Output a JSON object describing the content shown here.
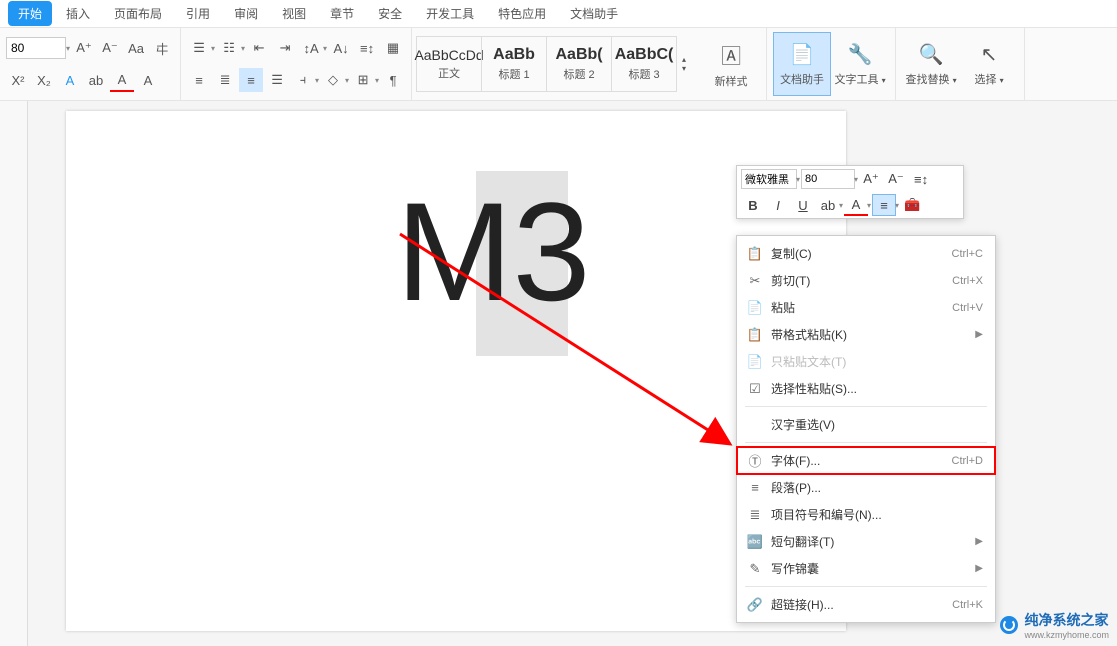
{
  "tabs": [
    "开始",
    "插入",
    "页面布局",
    "引用",
    "审阅",
    "视图",
    "章节",
    "安全",
    "开发工具",
    "特色应用",
    "文档助手"
  ],
  "active_tab": 0,
  "ribbon": {
    "font_size": "80",
    "styles": [
      {
        "preview": "AaBbCcDd",
        "label": "正文",
        "bold": false
      },
      {
        "preview": "AaBb",
        "label": "标题 1",
        "bold": true
      },
      {
        "preview": "AaBb(",
        "label": "标题 2",
        "bold": true
      },
      {
        "preview": "AaBbC(",
        "label": "标题 3",
        "bold": true
      }
    ],
    "new_style": "新样式",
    "doc_helper": "文档助手",
    "text_tools": "文字工具",
    "find_replace": "查找替换",
    "select": "选择"
  },
  "document": {
    "text": "M3"
  },
  "float_toolbar": {
    "font_name": "微软雅黑",
    "font_size": "80"
  },
  "context_menu": [
    {
      "icon": "📋",
      "label": "复制(C)",
      "shortcut": "Ctrl+C"
    },
    {
      "icon": "✂",
      "label": "剪切(T)",
      "shortcut": "Ctrl+X"
    },
    {
      "icon": "📄",
      "label": "粘贴",
      "shortcut": "Ctrl+V"
    },
    {
      "icon": "📋",
      "label": "带格式粘贴(K)",
      "arrow": true
    },
    {
      "icon": "📄",
      "label": "只粘贴文本(T)",
      "disabled": true
    },
    {
      "icon": "☑",
      "label": "选择性粘贴(S)..."
    },
    {
      "sep": true
    },
    {
      "icon": "",
      "label": "汉字重选(V)"
    },
    {
      "sep": true
    },
    {
      "icon": "Ⓣ",
      "label": "字体(F)...",
      "shortcut": "Ctrl+D",
      "highlighted": true
    },
    {
      "icon": "≡",
      "label": "段落(P)..."
    },
    {
      "icon": "≣",
      "label": "项目符号和编号(N)..."
    },
    {
      "icon": "🔤",
      "label": "短句翻译(T)",
      "arrow": true
    },
    {
      "icon": "✎",
      "label": "写作锦囊",
      "arrow": true
    },
    {
      "sep": true
    },
    {
      "icon": "🔗",
      "label": "超链接(H)...",
      "shortcut": "Ctrl+K"
    }
  ],
  "watermark": {
    "title": "纯净系统之家",
    "url": "www.kzmyhome.com"
  }
}
